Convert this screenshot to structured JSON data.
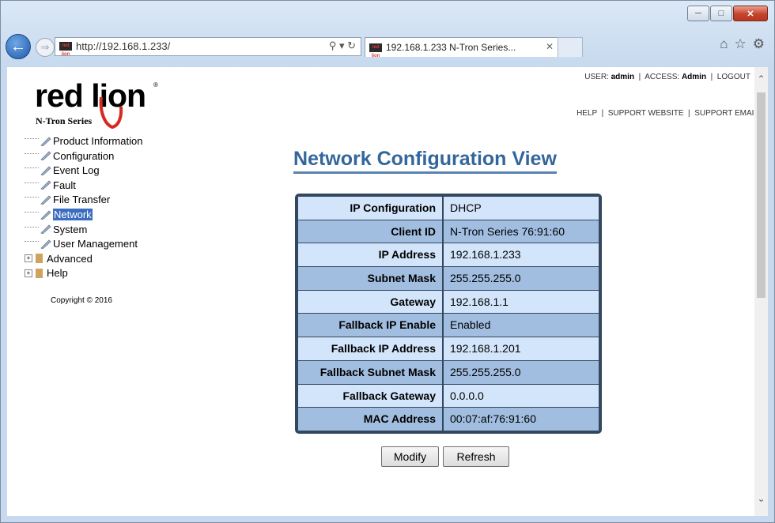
{
  "browser": {
    "url": "http://192.168.1.233/",
    "tab_title": "192.168.1.233 N-Tron Series...",
    "favicon_text": "red lion"
  },
  "logo": {
    "brand": "red lion",
    "subtitle": "N-Tron Series",
    "registered": "®",
    "brand_color": "#d42a20"
  },
  "header": {
    "user_label": "USER:",
    "user": "admin",
    "access_label": "ACCESS:",
    "access": "Admin",
    "logout": "LOGOUT",
    "links": [
      "HELP",
      "SUPPORT WEBSITE",
      "SUPPORT EMAIL"
    ]
  },
  "nav": {
    "items": [
      {
        "label": "Product Information",
        "type": "page"
      },
      {
        "label": "Configuration",
        "type": "page"
      },
      {
        "label": "Event Log",
        "type": "page"
      },
      {
        "label": "Fault",
        "type": "page"
      },
      {
        "label": "File Transfer",
        "type": "page"
      },
      {
        "label": "Network",
        "type": "page",
        "selected": true
      },
      {
        "label": "System",
        "type": "page"
      },
      {
        "label": "User Management",
        "type": "page"
      },
      {
        "label": "Advanced",
        "type": "folder"
      },
      {
        "label": "Help",
        "type": "folder"
      }
    ],
    "copyright": "Copyright © 2016"
  },
  "main": {
    "title": "Network Configuration View",
    "rows": [
      {
        "key": "IP Configuration",
        "value": "DHCP"
      },
      {
        "key": "Client ID",
        "value": "N-Tron Series 76:91:60"
      },
      {
        "key": "IP Address",
        "value": "192.168.1.233"
      },
      {
        "key": "Subnet Mask",
        "value": "255.255.255.0"
      },
      {
        "key": "Gateway",
        "value": "192.168.1.1"
      },
      {
        "key": "Fallback IP Enable",
        "value": "Enabled"
      },
      {
        "key": "Fallback IP Address",
        "value": "192.168.1.201"
      },
      {
        "key": "Fallback Subnet Mask",
        "value": "255.255.255.0"
      },
      {
        "key": "Fallback Gateway",
        "value": "0.0.0.0"
      },
      {
        "key": "MAC Address",
        "value": "00:07:af:76:91:60"
      }
    ],
    "buttons": {
      "modify": "Modify",
      "refresh": "Refresh"
    }
  },
  "colors": {
    "title": "#33669c",
    "row_light": "#d3e5fa",
    "row_dark": "#a1bde0",
    "table_border": "#33475e",
    "selected_nav": "#3b6dc1"
  }
}
